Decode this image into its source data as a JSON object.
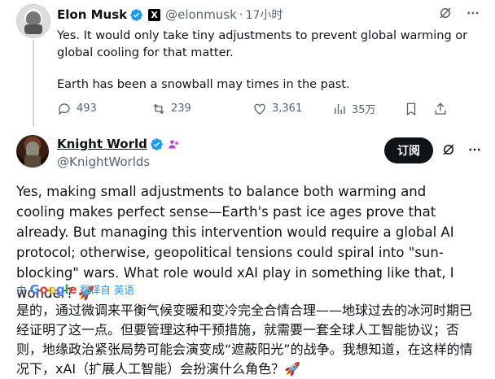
{
  "original_post": {
    "name": "Elon Musk",
    "handle": "@elonmusk",
    "time": "17小时",
    "para1": "Yes. It would only take tiny adjustments to prevent global warming or global cooling for that matter.",
    "para2": "Earth has been a snowball may times in the past.",
    "stats": {
      "replies": "493",
      "reposts": "239",
      "likes": "3,361",
      "views": "35万"
    }
  },
  "reply_post": {
    "name": "Knight World",
    "handle": "@KnightWorlds",
    "subscribe_label": "订阅",
    "text": "Yes, making small adjustments to balance both warming and cooling makes perfect sense—Earth's past ice ages prove that already. But managing this intervention would require a global AI protocol; otherwise, geopolitical tensions could spiral into \"sun-blocking\" wars. What role would xAI play in something like that, I wonder? 🚀",
    "translate_prefix": "由",
    "translate_label": "翻译自 英语",
    "translation": "是的，通过微调来平衡气候变暖和变冷完全合情合理——地球过去的冰河时期已经证明了这一点。但要管理这种干预措施，就需要一套全球人工智能协议；否则，地缘政治紧张局势可能会演变成“遮蔽阳光”的战争。我想知道，在这样的情况下，xAI（扩展人工智能）会扮演什么角色？🚀"
  },
  "colors": {
    "verified_blue": "#1d9bf0",
    "text_primary": "#0f1419",
    "text_muted": "#536471",
    "button_dark": "#0f1419"
  },
  "icons": [
    "grok-slash-icon",
    "more-icon",
    "reply-icon",
    "repost-icon",
    "like-icon",
    "views-icon",
    "bookmark-icon",
    "share-icon",
    "verified-icon",
    "x-badge-icon",
    "affiliate-icon"
  ]
}
